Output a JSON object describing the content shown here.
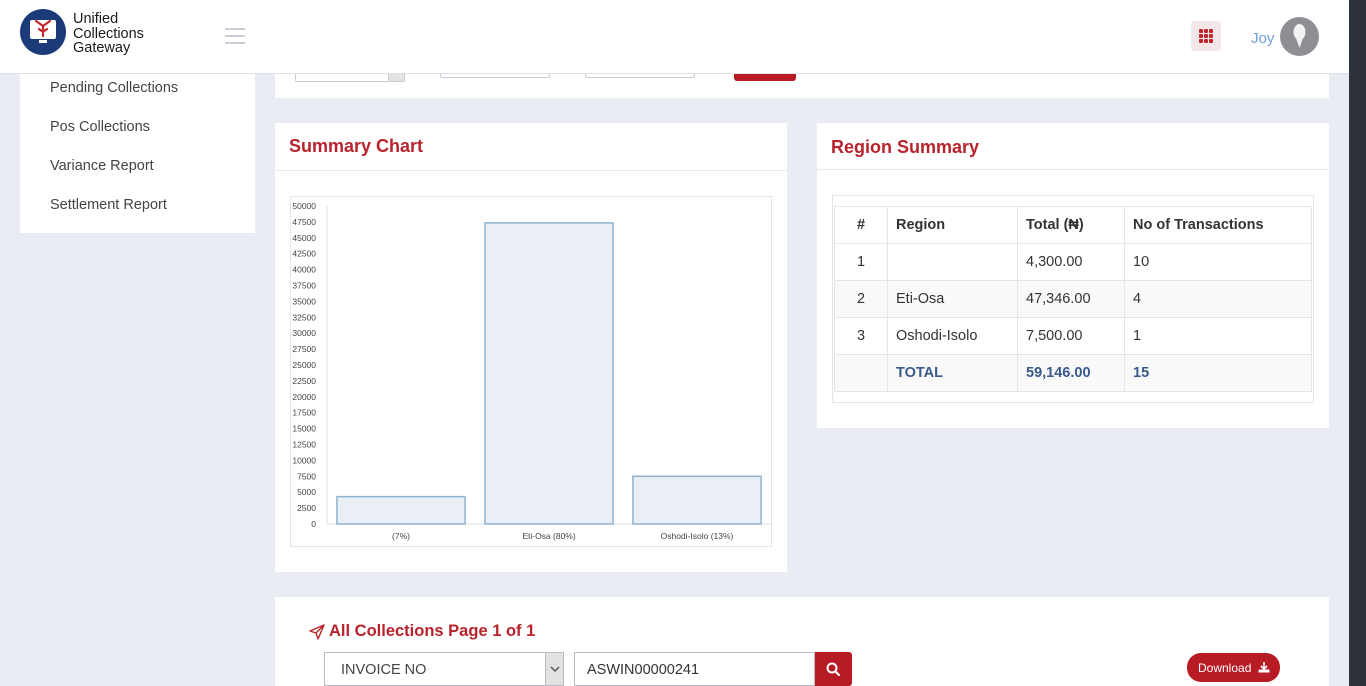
{
  "header": {
    "brand_line1": "Unified",
    "brand_line2": "Collections",
    "brand_line3": "Gateway",
    "user_name": "Joy"
  },
  "sidebar": {
    "items": [
      {
        "label": "Pending Collections"
      },
      {
        "label": "Pos Collections"
      },
      {
        "label": "Variance Report"
      },
      {
        "label": "Settlement Report"
      }
    ]
  },
  "summary_chart": {
    "title": "Summary Chart"
  },
  "chart_data": {
    "type": "bar",
    "categories": [
      "(7%)",
      "Eti-Osa (80%)",
      "Oshodi-Isolo (13%)"
    ],
    "values": [
      4300,
      47346,
      7500
    ],
    "ylim": [
      0,
      50000
    ],
    "yticks": [
      0,
      2500,
      5000,
      7500,
      10000,
      12500,
      15000,
      17500,
      20000,
      22500,
      25000,
      27500,
      30000,
      32500,
      35000,
      37500,
      40000,
      42500,
      45000,
      47500,
      50000
    ],
    "grid": false,
    "colors": {
      "fill": "#e9eff4",
      "stroke": "#8fb3d1"
    }
  },
  "region_summary": {
    "title": "Region Summary",
    "headers": [
      "#",
      "Region",
      "Total (₦)",
      "No of Transactions"
    ],
    "rows": [
      {
        "num": "1",
        "region": "",
        "total": "4,300.00",
        "count": "10"
      },
      {
        "num": "2",
        "region": "Eti-Osa",
        "total": "47,346.00",
        "count": "4"
      },
      {
        "num": "3",
        "region": "Oshodi-Isolo",
        "total": "7,500.00",
        "count": "1"
      }
    ],
    "total_row": {
      "label": "TOTAL",
      "total": "59,146.00",
      "count": "15"
    }
  },
  "collections": {
    "title": "All Collections Page 1 of 1",
    "filter_selected": "INVOICE NO",
    "search_value": "ASWIN00000241",
    "download_label": "Download"
  },
  "colors": {
    "accent": "#b71c25",
    "title": "#b8232c",
    "link": "#6f9fd8",
    "background": "#e9ecf2"
  }
}
